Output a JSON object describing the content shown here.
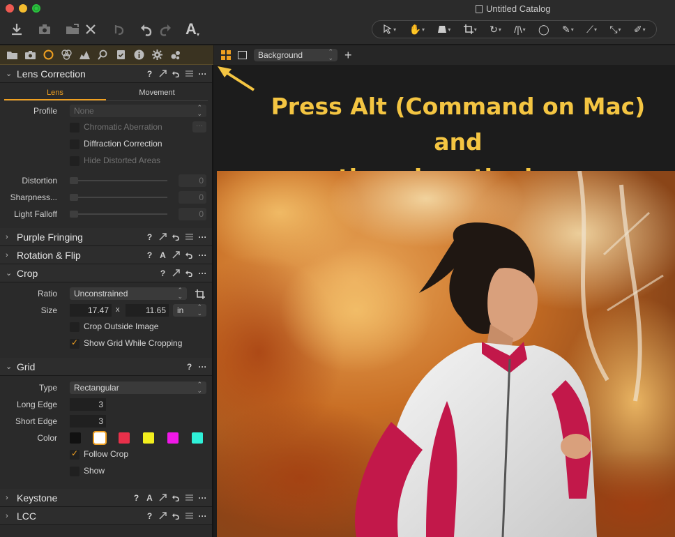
{
  "window": {
    "title": "Untitled Catalog"
  },
  "toolbar": {
    "buttons": [
      "import-icon",
      "camera-icon",
      "folder-move-icon",
      "delete-icon",
      "undo-history-icon",
      "undo-icon",
      "redo-icon",
      "text-icon"
    ],
    "cursor_tools": [
      "select-cursor",
      "hand-cursor",
      "keystone-cursor",
      "crop-cursor",
      "rotate-cursor",
      "straighten-cursor",
      "circle-cursor",
      "brush-cursor",
      "picker-cursor",
      "wb-picker-cursor",
      "eraser-cursor"
    ]
  },
  "tool_tabs": [
    "library",
    "capture",
    "color",
    "exposure",
    "lens",
    "details",
    "adjustments",
    "metadata",
    "output",
    "batch"
  ],
  "viewer_bar": {
    "layer_select": "Background"
  },
  "tools": {
    "lens_correction": {
      "title": "Lens Correction",
      "tabs": [
        "Lens",
        "Movement"
      ],
      "profile_label": "Profile",
      "profile_value": "None",
      "chromatic_aberration": "Chromatic Aberration",
      "chromatic_btn": "···",
      "diffraction": "Diffraction Correction",
      "hide_distorted": "Hide Distorted Areas",
      "sliders": [
        {
          "label": "Distortion",
          "value": "0"
        },
        {
          "label": "Sharpness...",
          "value": "0"
        },
        {
          "label": "Light Falloff",
          "value": "0"
        }
      ]
    },
    "purple_fringing": {
      "title": "Purple Fringing"
    },
    "rotation_flip": {
      "title": "Rotation & Flip"
    },
    "crop": {
      "title": "Crop",
      "ratio_label": "Ratio",
      "ratio_value": "Unconstrained",
      "size_label": "Size",
      "width": "17.47",
      "times": "x",
      "height": "11.65",
      "unit": "in",
      "crop_outside": "Crop Outside Image",
      "show_grid": "Show Grid While Cropping"
    },
    "grid": {
      "title": "Grid",
      "type_label": "Type",
      "type_value": "Rectangular",
      "long_edge_label": "Long Edge",
      "long_edge": "3",
      "short_edge_label": "Short Edge",
      "short_edge": "3",
      "color_label": "Color",
      "colors": [
        "#111111",
        "#ffffff",
        "#e8304a",
        "#f2ee1e",
        "#f018e8",
        "#2ff0d8"
      ],
      "follow_crop": "Follow Crop",
      "show": "Show"
    },
    "keystone": {
      "title": "Keystone"
    },
    "lcc": {
      "title": "LCC"
    },
    "header_icons": {
      "help": "?",
      "auto": "A",
      "more": "···"
    }
  },
  "annotation": {
    "line1": "Press Alt (Command on Mac) and",
    "line2": "then drag the icon"
  }
}
